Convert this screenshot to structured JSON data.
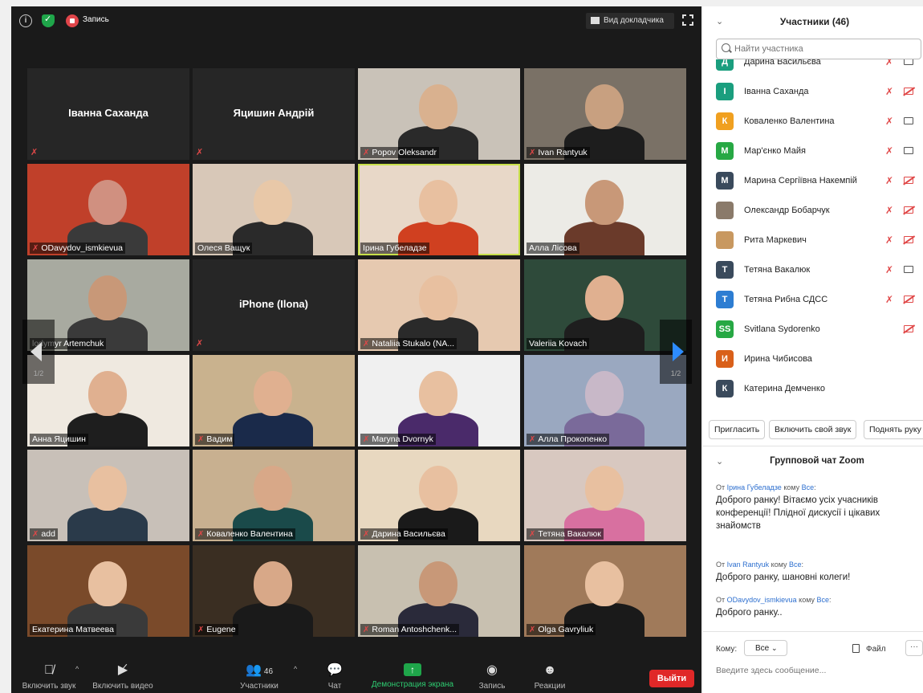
{
  "top_bar": {
    "record_label": "Запись",
    "speaker_view_label": "Вид докладчика"
  },
  "grid": {
    "page_left": "1/2",
    "page_right": "1/2",
    "tiles": [
      {
        "name": "Іванна Саханда",
        "mode": "text",
        "muted": true
      },
      {
        "name": "Яцишин Андрій",
        "mode": "text",
        "muted": true
      },
      {
        "name": "Popov Oleksandr",
        "mode": "video",
        "muted": true
      },
      {
        "name": "Ivan Rantyuk",
        "mode": "video",
        "muted": true
      },
      {
        "name": "ODavydov_ismkievua",
        "mode": "video",
        "muted": true
      },
      {
        "name": "Олеся Ващук",
        "mode": "video",
        "muted": false
      },
      {
        "name": "Ірина Губеладзе",
        "mode": "video",
        "muted": false
      },
      {
        "name": "Алла Лісова",
        "mode": "video",
        "muted": false
      },
      {
        "name": "lodymyr Artemchuk",
        "mode": "video",
        "muted": false
      },
      {
        "name": "iPhone (Ilona)",
        "mode": "text",
        "muted": true
      },
      {
        "name": "Nataliia Stukalo (NA...",
        "mode": "video",
        "muted": true
      },
      {
        "name": "Valeriia Kovach",
        "mode": "video",
        "muted": false
      },
      {
        "name": "Анна Яцишин",
        "mode": "video",
        "muted": false
      },
      {
        "name": "Вадим",
        "mode": "video",
        "muted": true
      },
      {
        "name": "Maryna Dvornyk",
        "mode": "video",
        "muted": true
      },
      {
        "name": "Алла Прокопенко",
        "mode": "video",
        "muted": true
      },
      {
        "name": "add",
        "mode": "video",
        "muted": true
      },
      {
        "name": "Коваленко Валентина",
        "mode": "video",
        "muted": true
      },
      {
        "name": "Дарина Васильєва",
        "mode": "video",
        "muted": true
      },
      {
        "name": "Тетяна Вакалюк",
        "mode": "video",
        "muted": true
      },
      {
        "name": "Екатерина Матвеева",
        "mode": "video",
        "muted": false
      },
      {
        "name": "Eugene",
        "mode": "video",
        "muted": true
      },
      {
        "name": "Roman Antoshchenk...",
        "mode": "video",
        "muted": true
      },
      {
        "name": "Olga Gavryliuk",
        "mode": "video",
        "muted": true
      }
    ]
  },
  "controls": {
    "unmute_label": "Включить звук",
    "start_video_label": "Включить видео",
    "participants_label": "Участники",
    "participants_count": "46",
    "chat_label": "Чат",
    "share_label": "Демонстрация экрана",
    "record_label": "Запись",
    "reactions_label": "Реакции",
    "leave_label": "Выйти"
  },
  "participants_panel": {
    "title": "Участники (46)",
    "search_placeholder": "Найти участника",
    "items": [
      {
        "initial": "Д",
        "color": "#1a9e7e",
        "name": "Дарина Васильєва",
        "cam_off": false,
        "mic": true
      },
      {
        "initial": "І",
        "color": "#1a9e7e",
        "name": "Іванна Саханда",
        "cam_off": true,
        "mic": true
      },
      {
        "initial": "К",
        "color": "#f0a020",
        "name": "Коваленко Валентина",
        "cam_off": false,
        "mic": true
      },
      {
        "initial": "М",
        "color": "#27a844",
        "name": "Мар'єнко Майя",
        "cam_off": false,
        "mic": true
      },
      {
        "initial": "М",
        "color": "#3a4a5c",
        "name": "Марина Сергіївна Накемпій",
        "cam_off": true,
        "mic": true
      },
      {
        "initial": "",
        "color": "#8a7a6a",
        "name": "Олександр Бобарчук",
        "cam_off": true,
        "mic": true
      },
      {
        "initial": "",
        "color": "#c89860",
        "name": "Рита Маркевич",
        "cam_off": true,
        "mic": true
      },
      {
        "initial": "Т",
        "color": "#3a4a5c",
        "name": "Тетяна Вакалюк",
        "cam_off": false,
        "mic": true
      },
      {
        "initial": "Т",
        "color": "#2d7dd2",
        "name": "Тетяна Рибна СДСС",
        "cam_off": true,
        "mic": true
      },
      {
        "initial": "SS",
        "color": "#27a844",
        "name": "Svitlana Sydorenko",
        "cam_off": true,
        "mic": false
      },
      {
        "initial": "И",
        "color": "#d9601a",
        "name": "Ирина Чибисова",
        "cam_off": false,
        "mic": false,
        "no_icons": true
      },
      {
        "initial": "К",
        "color": "#3a4a5c",
        "name": "Катерина Демченко",
        "cam_off": false,
        "mic": false,
        "no_icons": true
      }
    ],
    "invite_label": "Пригласить",
    "unmute_me_label": "Включить свой звук",
    "raise_hand_label": "Поднять руку"
  },
  "chat": {
    "title": "Групповой чат Zoom",
    "messages": [
      {
        "from_prefix": "От",
        "from": "Ірина Губеладзе",
        "to_prefix": "кому",
        "to": "Все",
        "text": "Доброго ранку! Вітаємо усіх учасників конференції! Плідної дискусії і цікавих знайомств"
      },
      {
        "from_prefix": "От",
        "from": "Ivan Rantyuk",
        "to_prefix": "кому",
        "to": "Все",
        "text": "Доброго ранку, шановні колеги!"
      },
      {
        "from_prefix": "От",
        "from": "ODavydov_ismkievua",
        "to_prefix": "кому",
        "to": "Все",
        "text": "Доброго ранку.."
      }
    ],
    "to_label": "Кому:",
    "to_value": "Все",
    "file_label": "Файл",
    "more_label": "···",
    "input_placeholder": "Введите здесь сообщение..."
  }
}
